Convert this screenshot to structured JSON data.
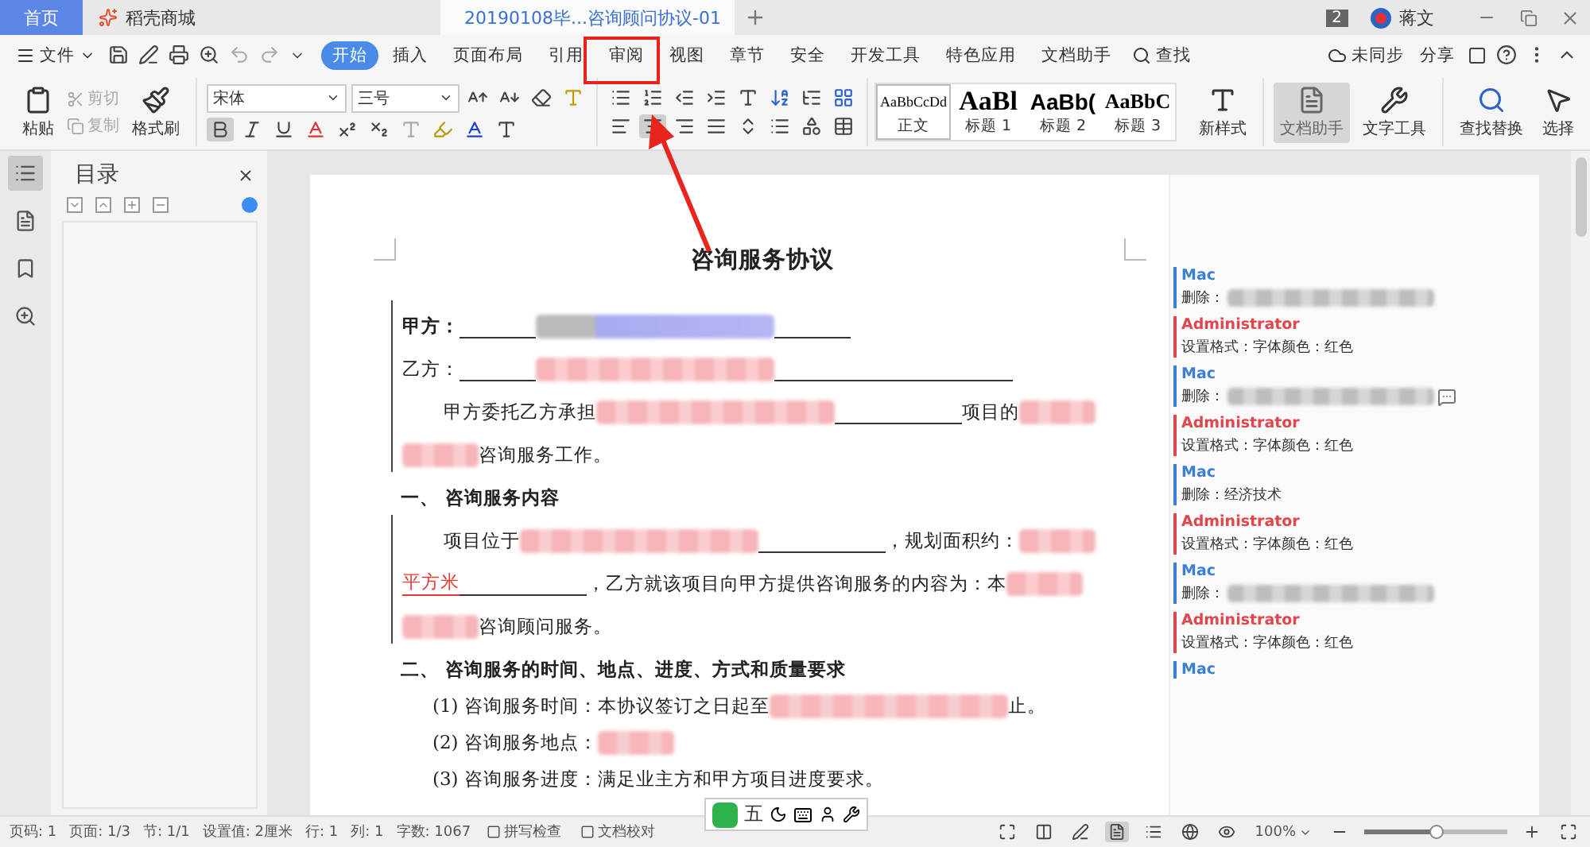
{
  "tabs": [
    {
      "label": "首页",
      "kind": "home",
      "selected": false
    },
    {
      "label": "稻壳商城",
      "kind": "store",
      "selected": false
    },
    {
      "label": "20190108毕...咨询顾问协议-01",
      "kind": "doc",
      "selected": true
    }
  ],
  "titlebar": {
    "count": "2",
    "user": "蒋文"
  },
  "menu": {
    "file": "文件",
    "tabs": [
      {
        "label": "开始",
        "selected": true
      },
      {
        "label": "插入",
        "selected": false
      },
      {
        "label": "页面布局",
        "selected": false
      },
      {
        "label": "引用",
        "selected": false
      },
      {
        "label": "审阅",
        "selected": false
      },
      {
        "label": "视图",
        "selected": false
      },
      {
        "label": "章节",
        "selected": false
      },
      {
        "label": "安全",
        "selected": false
      },
      {
        "label": "开发工具",
        "selected": false
      },
      {
        "label": "特色应用",
        "selected": false
      },
      {
        "label": "文档助手",
        "selected": false
      }
    ],
    "search": "查找",
    "sync": "未同步",
    "share": "分享"
  },
  "ribbon": {
    "paste": "粘贴",
    "cut": "剪切",
    "copy": "复制",
    "format_painter": "格式刷",
    "font": "宋体",
    "size": "三号",
    "format": {
      "bold": true,
      "italic": false,
      "underline": false
    },
    "align": [
      {
        "kind": "left",
        "selected": false
      },
      {
        "kind": "center",
        "selected": true
      },
      {
        "kind": "right",
        "selected": false
      },
      {
        "kind": "justify",
        "selected": false
      }
    ],
    "styles": [
      {
        "kind": "body",
        "preview": "AaBbCcDd",
        "label": "正文",
        "selected": true
      },
      {
        "kind": "h1",
        "preview": "AaBl",
        "label": "标题 1",
        "selected": false
      },
      {
        "kind": "h2",
        "preview": "AaBb(",
        "label": "标题 2",
        "selected": false
      },
      {
        "kind": "h3",
        "preview": "AaBbC",
        "label": "标题 3",
        "selected": false
      }
    ],
    "new_style": "新样式",
    "doc_assistant": "文档助手",
    "doc_assistant_on": true,
    "text_tools": "文字工具",
    "find_replace": "查找替换",
    "select": "选择"
  },
  "nav": {
    "title": "目录"
  },
  "document": {
    "title": "咨询服务协议",
    "paragraphs": [
      {
        "kind": "flush",
        "segments": [
          {
            "kind": "bold",
            "text": "甲方："
          },
          {
            "kind": "shortblank"
          },
          {
            "kind": "blueredacted"
          },
          {
            "kind": "shortblank"
          }
        ]
      },
      {
        "kind": "flush",
        "segments": [
          {
            "kind": "text",
            "text": "乙方："
          },
          {
            "kind": "shortblank"
          },
          {
            "kind": "redacted"
          },
          {
            "kind": "longblank"
          }
        ]
      },
      {
        "kind": "indent",
        "segments": [
          {
            "kind": "text",
            "text": "甲方委托乙方承担"
          },
          {
            "kind": "redacted"
          },
          {
            "kind": "blank"
          },
          {
            "kind": "text",
            "text": "项目的"
          },
          {
            "kind": "shortredacted"
          }
        ]
      },
      {
        "kind": "flush",
        "segments": [
          {
            "kind": "shortredacted"
          },
          {
            "kind": "text",
            "text": "咨询服务工作。"
          }
        ]
      },
      {
        "kind": "heading",
        "segments": [
          {
            "kind": "bold",
            "text": "一、  咨询服务内容"
          }
        ]
      },
      {
        "kind": "indent",
        "segments": [
          {
            "kind": "text",
            "text": "项目位于 "
          },
          {
            "kind": "redacted"
          },
          {
            "kind": "blank"
          },
          {
            "kind": "text",
            "text": "，规划面积约："
          },
          {
            "kind": "shortredacted"
          }
        ]
      },
      {
        "kind": "flush",
        "segments": [
          {
            "kind": "red",
            "text": "平方米"
          },
          {
            "kind": "blank"
          },
          {
            "kind": "text",
            "text": "，乙方就该项目向甲方提供咨询服务的内容为：本"
          },
          {
            "kind": "shortredacted"
          }
        ]
      },
      {
        "kind": "flush",
        "segments": [
          {
            "kind": "shortredacted"
          },
          {
            "kind": "text",
            "text": "咨询顾问服务。"
          }
        ]
      },
      {
        "kind": "heading",
        "segments": [
          {
            "kind": "bold",
            "text": "二、  咨询服务的时间、地点、进度、方式和质量要求"
          }
        ]
      },
      {
        "kind": "numbered",
        "segments": [
          {
            "kind": "text",
            "text": "(1)  咨询服务时间：本协议签订之日起至"
          },
          {
            "kind": "redacted"
          },
          {
            "kind": "text",
            "text": "止。"
          }
        ]
      },
      {
        "kind": "numbered",
        "segments": [
          {
            "kind": "text",
            "text": "(2)  咨询服务地点："
          },
          {
            "kind": "shortredacted"
          }
        ]
      },
      {
        "kind": "numbered",
        "segments": [
          {
            "kind": "text",
            "text": "(3)  咨询服务进度：满足业主方和甲方项目进度要求。"
          }
        ]
      }
    ]
  },
  "comments": [
    {
      "author": "Mac",
      "color": "#3b7fd6",
      "action": "删除：",
      "redacted": true
    },
    {
      "author": "Administrator",
      "color": "#e0474c",
      "action": "设置格式：字体颜色：红色"
    },
    {
      "author": "Mac",
      "color": "#3b7fd6",
      "action": "删除：",
      "redacted": true,
      "more": true
    },
    {
      "author": "Administrator",
      "color": "#e0474c",
      "action": "设置格式：字体颜色：红色"
    },
    {
      "author": "Mac",
      "color": "#3b7fd6",
      "action": "删除：经济技术"
    },
    {
      "author": "Administrator",
      "color": "#e0474c",
      "action": "设置格式：字体颜色：红色"
    },
    {
      "author": "Mac",
      "color": "#3b7fd6",
      "action": "删除：",
      "redacted": true
    },
    {
      "author": "Administrator",
      "color": "#e0474c",
      "action": "设置格式：字体颜色：红色"
    },
    {
      "author": "Mac",
      "color": "#3b7fd6"
    }
  ],
  "status": {
    "items": [
      "页码: 1",
      "页面: 1/3",
      "节: 1/1",
      "设置值: 2厘米",
      "行: 1",
      "列: 1",
      "字数: 1067"
    ],
    "spell": "拼写检查",
    "proof": "文档校对",
    "zoom": "100%",
    "level": 0.5
  },
  "ime": {
    "label": "五"
  }
}
